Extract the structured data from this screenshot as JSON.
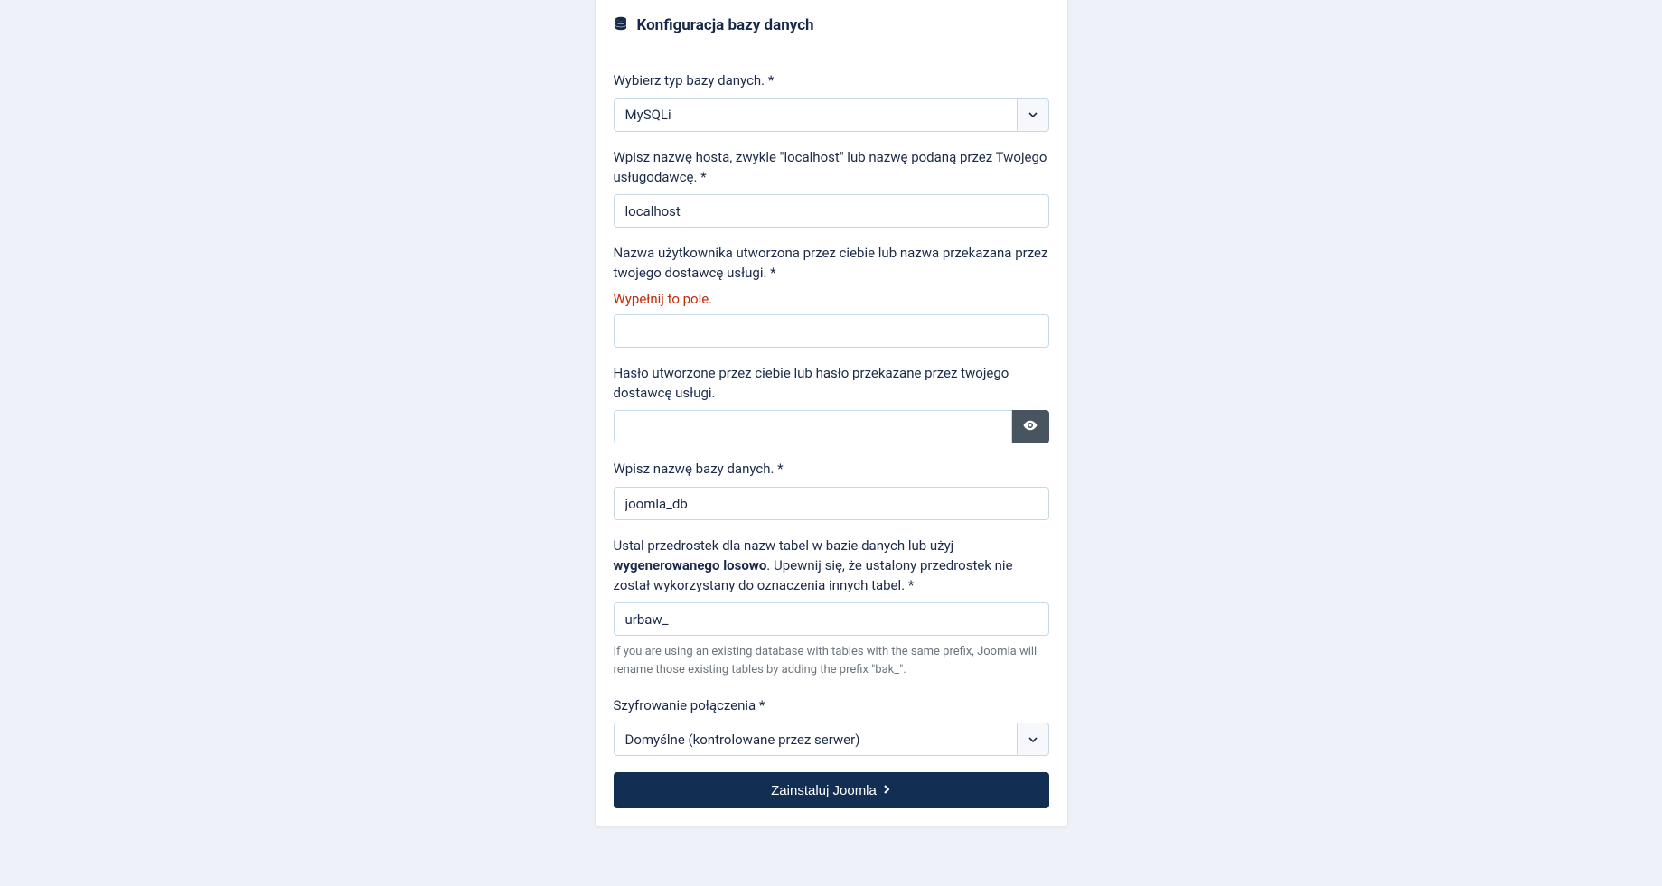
{
  "header": {
    "title": "Konfiguracja bazy danych"
  },
  "form": {
    "dbtype": {
      "label": "Wybierz typ bazy danych. *",
      "value": "MySQLi"
    },
    "host": {
      "label": "Wpisz nazwę hosta, zwykle \"localhost\" lub nazwę podaną przez Twojego usługodawcę. *",
      "value": "localhost"
    },
    "user": {
      "label": "Nazwa użytkownika utworzona przez ciebie lub nazwa przekazana przez twojego dostawcę usługi. *",
      "error": "Wypełnij to pole.",
      "value": ""
    },
    "password": {
      "label": "Hasło utworzone przez ciebie lub hasło przekazane przez twojego dostawcę usługi.",
      "value": ""
    },
    "dbname": {
      "label": "Wpisz nazwę bazy danych. *",
      "value": "joomla_db"
    },
    "prefix": {
      "label_part1": "Ustal przedrostek dla nazw tabel w bazie danych lub użyj ",
      "label_bold": "wygenerowanego losowo",
      "label_part2": ". Upewnij się, że ustalony przedrostek nie został wykorzystany do oznaczenia innych tabel. *",
      "value": "urbaw_",
      "help": "If you are using an existing database with tables with the same prefix, Joomla will rename those existing tables by adding the prefix \"bak_\"."
    },
    "encryption": {
      "label": "Szyfrowanie połączenia *",
      "value": "Domyślne (kontrolowane przez serwer)"
    }
  },
  "install_button": "Zainstaluj Joomla"
}
